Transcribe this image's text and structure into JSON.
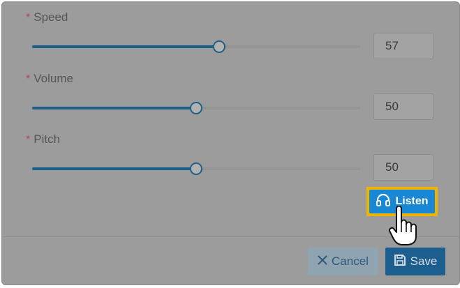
{
  "form": {
    "required_mark": "*",
    "fields": [
      {
        "label": "Speed",
        "value": "57",
        "percent": 57
      },
      {
        "label": "Volume",
        "value": "50",
        "percent": 50
      },
      {
        "label": "Pitch",
        "value": "50",
        "percent": 50
      }
    ]
  },
  "actions": {
    "listen_label": "Listen",
    "cancel_label": "Cancel",
    "save_label": "Save"
  },
  "icons": {
    "listen": "headphones-icon",
    "cancel": "close-icon",
    "save": "floppy-disk-icon",
    "cursor": "hand-pointer-icon"
  },
  "colors": {
    "slider_fill": "#1f5e86",
    "listen_button": "#1787d6",
    "highlight": "#f0b400",
    "save_button": "#1c5f8f"
  }
}
